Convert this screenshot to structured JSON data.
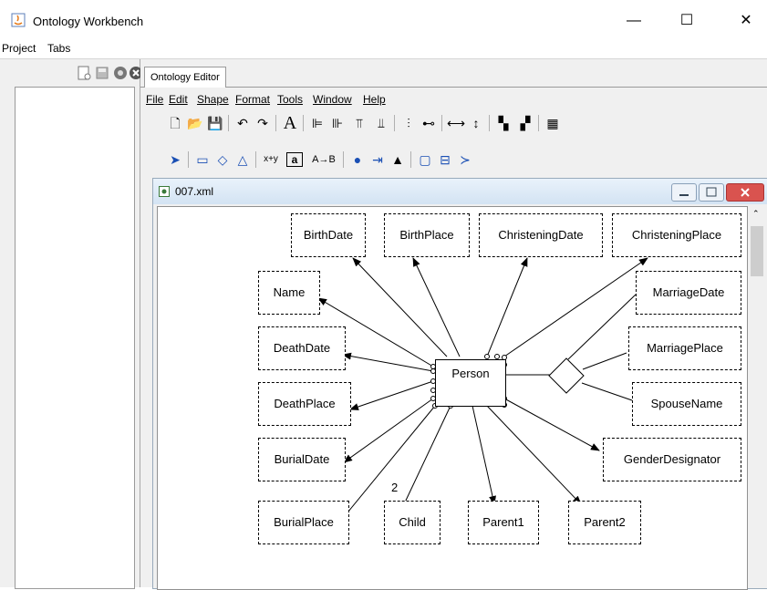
{
  "window": {
    "title": "Ontology Workbench",
    "minimize": "—",
    "maximize": "☐",
    "close": "✕"
  },
  "menubar": [
    "Project",
    "Tabs"
  ],
  "editor": {
    "tab_label": "Ontology Editor",
    "menu": [
      {
        "label": "File"
      },
      {
        "label": "Edit"
      },
      {
        "label": "Shape"
      },
      {
        "label": "Format"
      },
      {
        "label": "Tools"
      },
      {
        "label": "Window"
      },
      {
        "label": "Help"
      }
    ],
    "toolbar1": [
      "new-file-icon",
      "open-folder-icon",
      "save-icon",
      "undo-icon",
      "redo-icon",
      "font-icon",
      "align-left-icon",
      "align-center-icon",
      "align-top-icon",
      "align-bottom-icon",
      "distribute-h-icon",
      "distribute-v-icon",
      "same-width-icon",
      "same-height-icon",
      "bring-front-icon",
      "send-back-icon",
      "grid-icon"
    ],
    "toolbar2": [
      "select-arrow-icon",
      "rectangle-icon",
      "diamond-icon",
      "triangle-icon",
      "x-plus-y-icon",
      "a-box-icon",
      "a-to-b-icon",
      "dot-icon",
      "arrow-star-icon",
      "filled-triangle-icon",
      "rounded-rect-icon",
      "split-rect-icon",
      "fork-arrow-icon"
    ],
    "toolbar2_text": {
      "xy": "x+y",
      "a": "a",
      "ab": "A→B"
    }
  },
  "document": {
    "title": "007.xml"
  },
  "diagram": {
    "center": "Person",
    "cardinality": "2",
    "nodes": {
      "birthdate": "BirthDate",
      "birthplace": "BirthPlace",
      "christeningdate": "ChristeningDate",
      "christeningplace": "ChristeningPlace",
      "name": "Name",
      "marriagedate": "MarriageDate",
      "deathdate": "DeathDate",
      "marriageplace": "MarriagePlace",
      "deathplace": "DeathPlace",
      "spousename": "SpouseName",
      "burialdate": "BurialDate",
      "genderdesignator": "GenderDesignator",
      "burialplace": "BurialPlace",
      "child": "Child",
      "parent1": "Parent1",
      "parent2": "Parent2"
    }
  },
  "colors": {
    "frame_title_top": "#e9f2fb",
    "frame_title_bottom": "#d3e3f3",
    "close_red": "#d9534f"
  }
}
